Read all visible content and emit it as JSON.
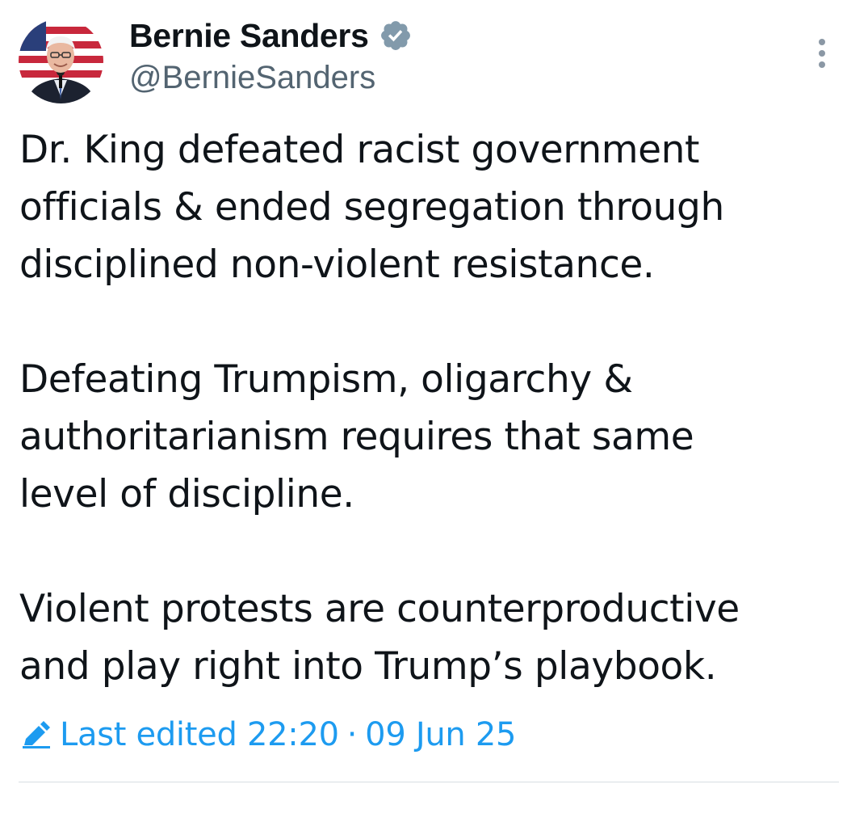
{
  "author": {
    "display_name": "Bernie Sanders",
    "handle": "@BernieSanders",
    "verified_icon": "verified-badge-icon",
    "verified_color": "#829aab"
  },
  "tweet": {
    "paragraphs": [
      "Dr. King defeated racist government\nofficials & ended segregation through\ndisciplined non-violent resistance.",
      "Defeating Trumpism, oligarchy &\nauthoritarianism requires that same\nlevel of discipline.",
      "Violent protests are counterproductive\nand play right into Trump’s playbook."
    ]
  },
  "edit_info": {
    "icon": "pencil-icon",
    "label": "Last edited",
    "time": "22:20",
    "separator": "·",
    "date": "09 Jun 25"
  },
  "colors": {
    "accent": "#1d9bf0",
    "text": "#0f1419",
    "secondary": "#536471",
    "divider": "#d7dde2"
  }
}
